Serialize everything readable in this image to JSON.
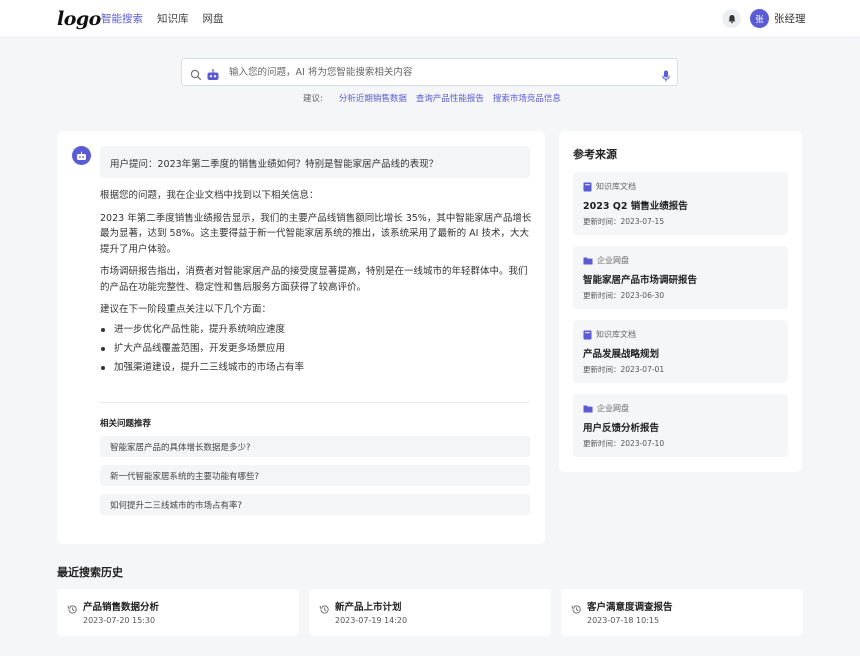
{
  "header": {
    "logo": "logo",
    "nav": [
      "智能搜索",
      "知识库",
      "网盘"
    ],
    "active_nav": 0,
    "avatar_text": "张",
    "user_name": "张经理",
    "accent_color": "#5b5bd6"
  },
  "search": {
    "placeholder": "输入您的问题，AI 将为您智能搜索相关内容",
    "value": "",
    "suggest_label": "建议:",
    "suggestions": [
      "分析近期销售数据",
      "查询产品性能报告",
      "搜索市场竞品信息"
    ]
  },
  "answer": {
    "question": "用户提问：2023年第二季度的销售业绩如何？特别是智能家居产品线的表现？",
    "paragraphs": [
      "根据您的问题，我在企业文档中找到以下相关信息：",
      "2023 年第二季度销售业绩报告显示，我们的主要产品线销售额同比增长 35%，其中智能家居产品增长最为显著，达到 58%。这主要得益于新一代智能家居系统的推出，该系统采用了最新的 AI 技术，大大提升了用户体验。",
      "市场调研报告指出，消费者对智能家居产品的接受度显著提高，特别是在一线城市的年轻群体中。我们的产品在功能完整性、稳定性和售后服务方面获得了较高评价。",
      "建议在下一阶段重点关注以下几个方面："
    ],
    "bullets": [
      "进一步优化产品性能，提升系统响应速度",
      "扩大产品线覆盖范围，开发更多场景应用",
      "加强渠道建设，提升二三线城市的市场占有率"
    ],
    "related_title": "相关问题推荐",
    "related": [
      "智能家居产品的具体增长数据是多少?",
      "新一代智能家居系统的主要功能有哪些?",
      "如何提升二三线城市的市场占有率?"
    ]
  },
  "references": {
    "title": "参考来源",
    "items": [
      {
        "type": "知识库文档",
        "icon": "book-icon",
        "name": "2023 Q2 销售业绩报告",
        "date": "更新时间：2023-07-15"
      },
      {
        "type": "企业网盘",
        "icon": "folder-icon",
        "name": "智能家居产品市场调研报告",
        "date": "更新时间：2023-06-30"
      },
      {
        "type": "知识库文档",
        "icon": "book-icon",
        "name": "产品发展战略规划",
        "date": "更新时间：2023-07-01"
      },
      {
        "type": "企业网盘",
        "icon": "folder-icon",
        "name": "用户反馈分析报告",
        "date": "更新时间：2023-07-10"
      }
    ]
  },
  "history": {
    "title": "最近搜索历史",
    "items": [
      {
        "name": "产品销售数据分析",
        "date": "2023-07-20 15:30"
      },
      {
        "name": "新产品上市计划",
        "date": "2023-07-19 14:20"
      },
      {
        "name": "客户满意度调查报告",
        "date": "2023-07-18 10:15"
      }
    ]
  }
}
